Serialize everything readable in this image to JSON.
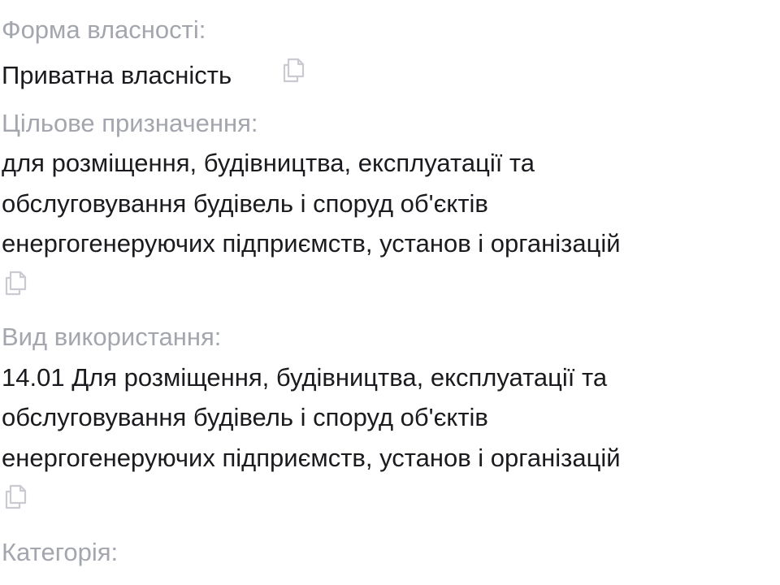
{
  "fields": [
    {
      "label": "Форма власності:",
      "value_lines": [
        "Приватна власність"
      ],
      "copy_icon": "copy-icon"
    },
    {
      "label": "Цільове призначення:",
      "value_lines": [
        "для розміщення, будівництва, експлуатації та",
        "обслуговування будівель і споруд об'єктів",
        "енергогенеруючих підприємств, установ і організацій"
      ],
      "copy_icon": "copy-icon"
    },
    {
      "label": "Вид використання:",
      "value_lines": [
        "14.01 Для розміщення, будівництва, експлуатації та",
        "обслуговування будівель і споруд об'єктів",
        "енергогенеруючих підприємств, установ і організацій"
      ],
      "copy_icon": "copy-icon"
    },
    {
      "label": "Категорія:",
      "value_lines": [],
      "copy_icon": ""
    }
  ],
  "colors": {
    "label": "#a4a6ae",
    "value": "#1b1b1f",
    "icon": "#c9cbd1"
  }
}
